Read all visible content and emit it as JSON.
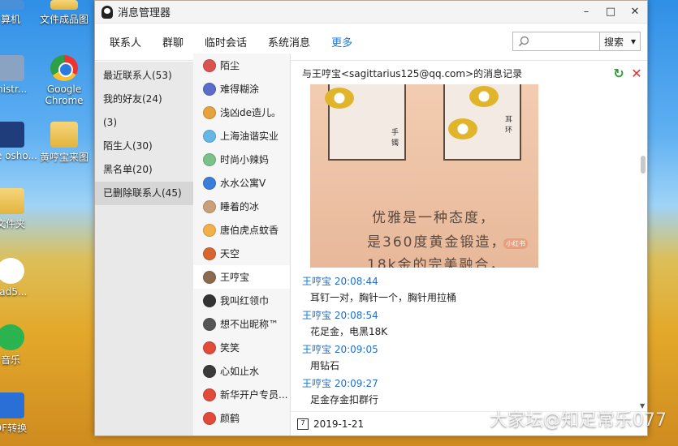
{
  "desktop": {
    "icons": [
      {
        "label": "算机",
        "icon": "computer-icon"
      },
      {
        "label": "文件成品图",
        "icon": "folder-icon"
      },
      {
        "label": "inistr...",
        "icon": "admin-tools-icon"
      },
      {
        "label": "Google Chrome",
        "icon": "chrome-icon"
      },
      {
        "label": "obe osho...",
        "icon": "photoshop-icon"
      },
      {
        "label": "黄哼宝来图",
        "icon": "folder-icon"
      },
      {
        "label": "文件夹",
        "icon": "folder-icon"
      },
      {
        "label": "cad5...",
        "icon": "qq-icon"
      },
      {
        "label": "音乐",
        "icon": "music-icon"
      },
      {
        "label": "DF转换",
        "icon": "pdf-icon"
      }
    ]
  },
  "window": {
    "title": "消息管理器",
    "buttons": {
      "min": "–",
      "max": "□",
      "close": "✕"
    },
    "nav": [
      {
        "label": "联系人",
        "active": false
      },
      {
        "label": "群聊",
        "active": false
      },
      {
        "label": "临时会话",
        "active": false
      },
      {
        "label": "系统消息",
        "active": false
      },
      {
        "label": "更多",
        "active": true
      }
    ],
    "search": {
      "placeholder": "",
      "scope": "搜索"
    },
    "groups": [
      {
        "label": "最近联系人(53)",
        "active": false
      },
      {
        "label": "我的好友(24)",
        "active": false
      },
      {
        "label": "(3)",
        "active": false
      },
      {
        "label": "陌生人(30)",
        "active": false
      },
      {
        "label": "黑名单(20)",
        "active": false
      },
      {
        "label": "已删除联系人(45)",
        "active": true
      }
    ],
    "contacts": [
      {
        "name": "陌尘",
        "color": "#d9534f"
      },
      {
        "name": "难得糊涂",
        "color": "#5b6cc9"
      },
      {
        "name": "浅凶de造儿。",
        "color": "#e6a23c"
      },
      {
        "name": "上海油谐实业",
        "color": "#67b7e6"
      },
      {
        "name": "时尚小辣妈",
        "color": "#7cc08a"
      },
      {
        "name": "水水公寓V",
        "color": "#3b7dd8"
      },
      {
        "name": "睡着的冰",
        "color": "#c9a07a"
      },
      {
        "name": "唐伯虎点蚊香",
        "color": "#f0b04a"
      },
      {
        "name": "天空",
        "color": "#d8652f"
      },
      {
        "name": "王哼宝",
        "color": "#8a6b50",
        "active": true
      },
      {
        "name": "我叫红领巾",
        "color": "#333333"
      },
      {
        "name": "想不出昵称™",
        "color": "#555555"
      },
      {
        "name": "笑笑",
        "color": "#e04b3a"
      },
      {
        "name": "心如止水",
        "color": "#3a3a3a"
      },
      {
        "name": "新华开户专员...",
        "color": "#e04b3a"
      },
      {
        "name": "颜鹤",
        "color": "#e04b3a"
      }
    ],
    "chat": {
      "header": "与王哼宝<sagittarius125@qq.com>的消息记录",
      "refresh_icon": "↻",
      "delete_icon": "✕",
      "image": {
        "tag_left": "手镯",
        "tag_right": "耳环",
        "line1": "优雅是一种态度，",
        "line2": "是360度黄金锻造，",
        "line3": "18k金的完美融合，",
        "badge": "小红书"
      },
      "messages": [
        {
          "sender": "王哼宝",
          "time": "20:08:44",
          "text": "耳钉一对，胸针一个，胸针用拉桶"
        },
        {
          "sender": "王哼宝",
          "time": "20:08:54",
          "text": "花足金，电黑18K"
        },
        {
          "sender": "王哼宝",
          "time": "20:09:05",
          "text": "用钻石"
        },
        {
          "sender": "王哼宝",
          "time": "20:09:27",
          "text": "足金存金扣群行"
        }
      ],
      "date": "2019-1-21",
      "calendar_icon": "7"
    },
    "watermark": "大家坛@知足常乐077"
  }
}
